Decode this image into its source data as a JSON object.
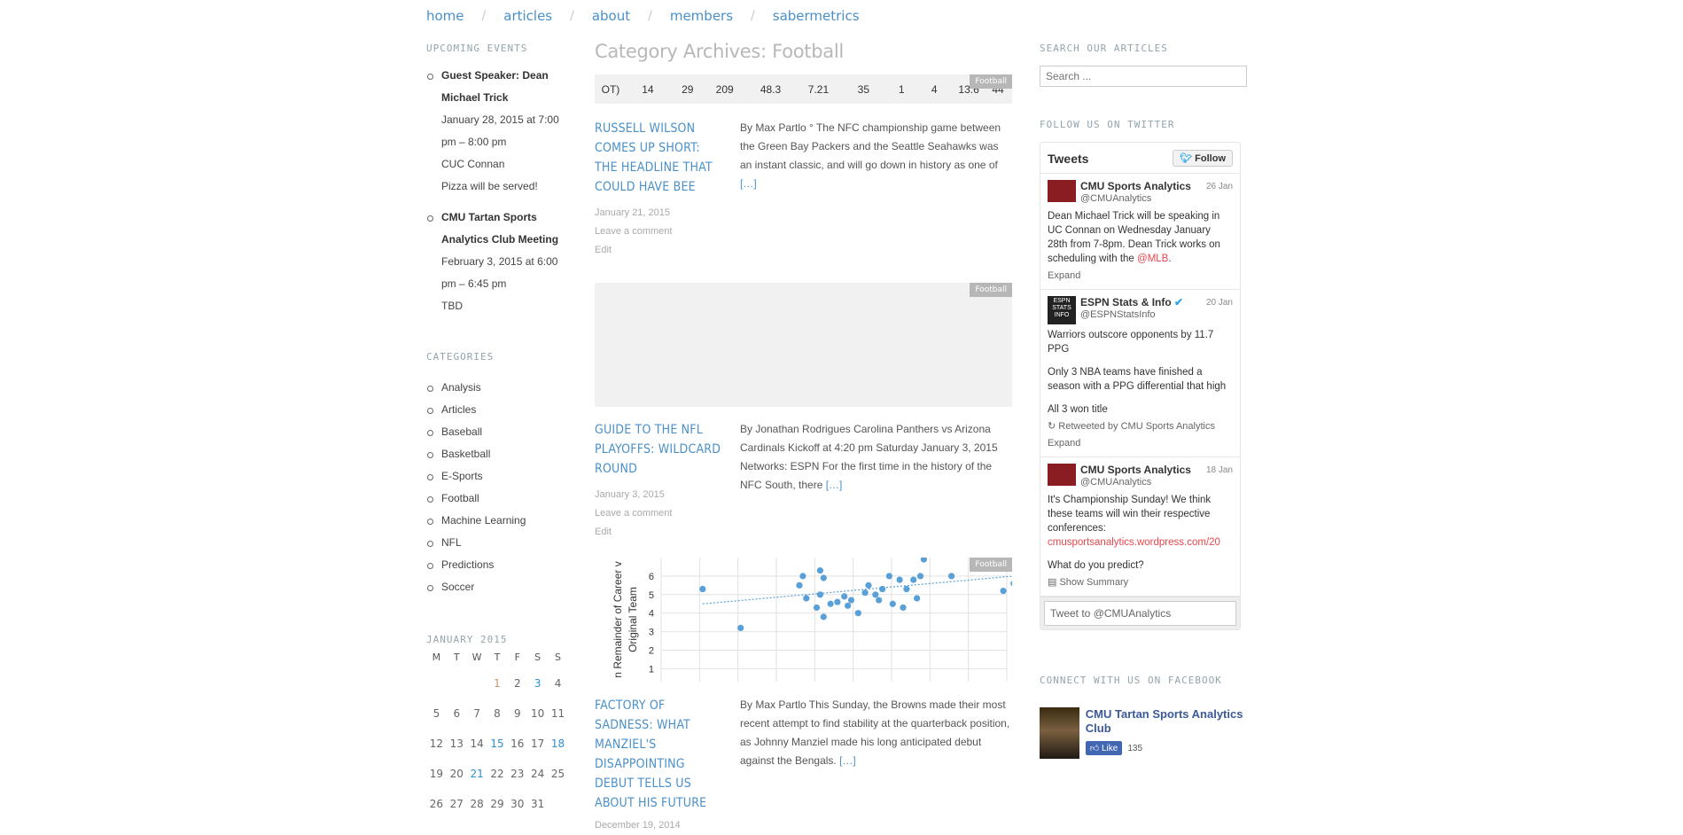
{
  "nav": [
    "home",
    "articles",
    "about",
    "members",
    "sabermetrics"
  ],
  "left": {
    "events_title": "UPCOMING EVENTS",
    "events": [
      {
        "title": "Guest Speaker: Dean Michael Trick",
        "when": "January 28, 2015 at 7:00 pm – 8:00 pm",
        "where": "CUC Connan",
        "note": "Pizza will be served!"
      },
      {
        "title": "CMU Tartan Sports Analytics Club Meeting",
        "when": "February 3, 2015 at 6:00 pm – 6:45 pm",
        "where": "TBD",
        "note": ""
      }
    ],
    "categories_title": "CATEGORIES",
    "categories": [
      "Analysis",
      "Articles",
      "Baseball",
      "Basketball",
      "E-Sports",
      "Football",
      "Machine Learning",
      "NFL",
      "Predictions",
      "Soccer"
    ],
    "calendar": {
      "title": "JANUARY 2015",
      "weekdays": [
        "M",
        "T",
        "W",
        "T",
        "F",
        "S",
        "S"
      ],
      "rows": [
        [
          "",
          "",
          "",
          "1",
          "2",
          "3",
          "4"
        ],
        [
          "5",
          "6",
          "7",
          "8",
          "9",
          "10",
          "11"
        ],
        [
          "12",
          "13",
          "14",
          "15",
          "16",
          "17",
          "18"
        ],
        [
          "19",
          "20",
          "21",
          "22",
          "23",
          "24",
          "25"
        ],
        [
          "26",
          "27",
          "28",
          "29",
          "30",
          "31",
          ""
        ]
      ],
      "linked_days": [
        "3",
        "15",
        "18",
        "21"
      ],
      "highlight_days": [
        "1"
      ]
    }
  },
  "main": {
    "page_title": "Category Archives: Football",
    "badge": "Football",
    "table_strip": [
      "OT)",
      "14",
      "29",
      "209",
      "48.3",
      "7.21",
      "35",
      "1",
      "4",
      "13.6",
      "44"
    ],
    "posts": [
      {
        "title": "RUSSELL WILSON COMES UP SHORT: THE HEADLINE THAT COULD HAVE BEE",
        "date": "January 21, 2015",
        "comment": "Leave a comment",
        "edit": "Edit",
        "excerpt": "By Max Partlo ° The NFC championship game between the Green Bay Packers and the Seattle Seahawks was an instant classic, and will go down in history as one of",
        "more": "[…]"
      },
      {
        "title": "GUIDE TO THE NFL PLAYOFFS: WILDCARD ROUND",
        "date": "January 3, 2015",
        "comment": "Leave a comment",
        "edit": "Edit",
        "excerpt": "By Jonathan Rodrigues Carolina Panthers vs Arizona Cardinals Kickoff at 4:20 pm Saturday January 3, 2015 Networks: ESPN For the first time in the history of the NFC South, there",
        "more": "[…]"
      },
      {
        "title": "FACTORY OF SADNESS: WHAT MANZIEL'S DISAPPOINTING DEBUT TELLS US ABOUT HIS FUTURE",
        "date": "December 19, 2014",
        "comment": "",
        "edit": "",
        "excerpt": "By Max Partlo This Sunday, the Browns made their most recent attempt to find stability at the quarterback position, as Johnny Manziel made his long anticipated debut against the Bengals.",
        "more": "[…]"
      }
    ],
    "chart_data": {
      "type": "scatter",
      "ylabel": "n Remainder of Career v Original Team",
      "yticks": [
        "1",
        "2",
        "3",
        "4",
        "5",
        "6"
      ],
      "ylim": [
        0.3,
        7
      ],
      "xlim": [
        0,
        10
      ],
      "points": [
        [
          1.2,
          5.3
        ],
        [
          2.3,
          3.2
        ],
        [
          4.0,
          5.5
        ],
        [
          4.1,
          6.0
        ],
        [
          4.2,
          4.8
        ],
        [
          4.5,
          4.3
        ],
        [
          4.6,
          5.0
        ],
        [
          4.7,
          3.8
        ],
        [
          4.6,
          6.3
        ],
        [
          4.7,
          5.9
        ],
        [
          4.9,
          4.5
        ],
        [
          5.1,
          4.6
        ],
        [
          5.3,
          4.9
        ],
        [
          5.4,
          4.4
        ],
        [
          5.5,
          4.7
        ],
        [
          5.7,
          4.0
        ],
        [
          5.9,
          5.1
        ],
        [
          6.0,
          5.5
        ],
        [
          6.2,
          5.0
        ],
        [
          6.3,
          4.7
        ],
        [
          6.4,
          5.3
        ],
        [
          6.6,
          6.0
        ],
        [
          6.7,
          4.5
        ],
        [
          6.9,
          5.8
        ],
        [
          7.0,
          4.3
        ],
        [
          7.1,
          5.3
        ],
        [
          7.3,
          5.8
        ],
        [
          7.4,
          4.8
        ],
        [
          7.5,
          6.0
        ],
        [
          7.6,
          6.9
        ],
        [
          8.4,
          6.0
        ],
        [
          9.2,
          6.4
        ],
        [
          9.3,
          6.7
        ],
        [
          9.9,
          5.2
        ],
        [
          10.2,
          5.6
        ]
      ],
      "trend": [
        [
          1.2,
          4.5
        ],
        [
          10.2,
          6.0
        ]
      ],
      "color": "#5aa0d8"
    }
  },
  "right": {
    "search_title": "SEARCH OUR ARTICLES",
    "search_placeholder": "Search ...",
    "twitter_title": "FOLLOW US ON TWITTER",
    "tw_header": "Tweets",
    "tw_follow": "Follow",
    "tweets": [
      {
        "name": "CMU Sports Analytics",
        "handle": "@CMUAnalytics",
        "date": "26 Jan",
        "text": "Dean Michael Trick will be speaking in UC Connan on Wednesday January 28th from 7-8pm. Dean Trick works on scheduling with the",
        "link": "@MLB",
        "tail": ".",
        "action": "Expand"
      },
      {
        "name": "ESPN Stats & Info",
        "handle": "@ESPNStatsInfo",
        "date": "20 Jan",
        "text": "Warriors outscore opponents by 11.7 PPG",
        "text2": "Only 3 NBA teams have finished a season with a PPG differential that high",
        "text3": "All 3 won title",
        "retweet": "Retweeted by CMU Sports Analytics",
        "action": "Expand"
      },
      {
        "name": "CMU Sports Analytics",
        "handle": "@CMUAnalytics",
        "date": "18 Jan",
        "text": "It's Championship Sunday! We think these teams will win their respective conferences:",
        "link": "cmusportsanalytics.wordpress.com/20",
        "text2": "What do you predict?",
        "action": "Show Summary"
      }
    ],
    "tw_compose": "Tweet to @CMUAnalytics",
    "facebook_title": "CONNECT WITH US ON FACEBOOK",
    "fb_name": "CMU Tartan Sports Analytics Club",
    "fb_like": "Like",
    "fb_count": "135"
  }
}
